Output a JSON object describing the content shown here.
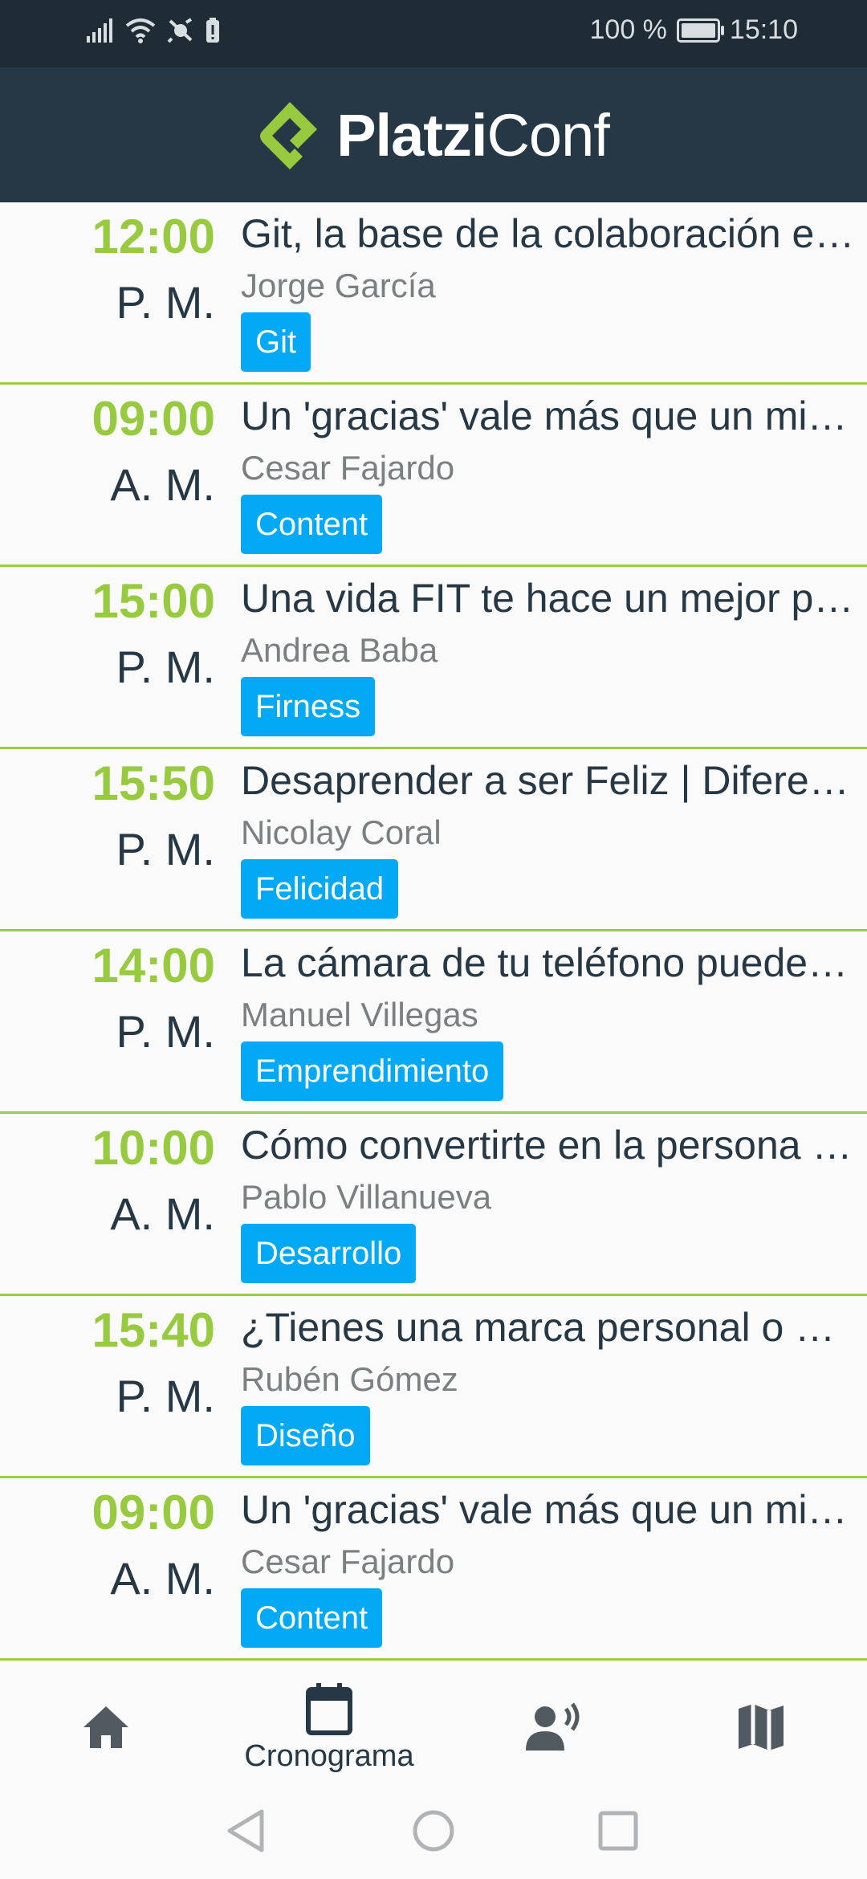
{
  "status": {
    "battery_percent": "100 %",
    "time": "15:10",
    "battery_level": 1.0
  },
  "header": {
    "logo_bold": "Platzi",
    "logo_light": "Conf",
    "accent": "#98ca3f",
    "background": "#263845"
  },
  "talks": [
    {
      "time": "12:00",
      "ampm": "P. M.",
      "title": "Git, la base de la colaboración en proyectos",
      "speaker": "Jorge García",
      "tag": "Git"
    },
    {
      "time": "09:00",
      "ampm": "A. M.",
      "title": "Un 'gracias' vale más que un millón de likes",
      "speaker": "Cesar Fajardo",
      "tag": "Content"
    },
    {
      "time": "15:00",
      "ampm": "P. M.",
      "title": "Una vida FIT te hace un mejor profesional",
      "speaker": "Andrea Baba",
      "tag": "Firness"
    },
    {
      "time": "15:50",
      "ampm": "P. M.",
      "title": "Desaprender a ser Feliz | Diferencias",
      "speaker": "Nicolay Coral",
      "tag": "Felicidad"
    },
    {
      "time": "14:00",
      "ampm": "P. M.",
      "title": "La cámara de tu teléfono puede más",
      "speaker": "Manuel Villegas",
      "tag": "Emprendimiento"
    },
    {
      "time": "10:00",
      "ampm": "A. M.",
      "title": "Cómo convertirte en la persona indicada",
      "speaker": "Pablo Villanueva",
      "tag": "Desarrollo"
    },
    {
      "time": "15:40",
      "ampm": "P. M.",
      "title": "¿Tienes una marca personal o solo un perfil?",
      "speaker": "Rubén Gómez",
      "tag": "Diseño"
    },
    {
      "time": "09:00",
      "ampm": "A. M.",
      "title": "Un 'gracias' vale más que un millón de likes",
      "speaker": "Cesar Fajardo",
      "tag": "Content"
    }
  ],
  "bottom_nav": {
    "items": [
      {
        "icon": "home-icon",
        "label": ""
      },
      {
        "icon": "calendar-icon",
        "label": "Cronograma"
      },
      {
        "icon": "speaker-icon",
        "label": ""
      },
      {
        "icon": "map-icon",
        "label": ""
      }
    ],
    "active": "Cronograma"
  },
  "colors": {
    "tag_background": "#03a9f4",
    "divider": "#9ccc47",
    "time": "#98ca3f"
  }
}
